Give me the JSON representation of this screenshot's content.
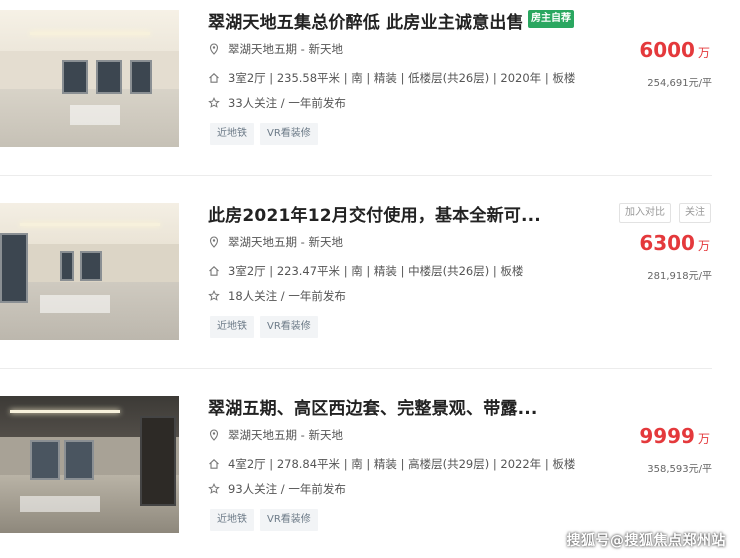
{
  "listings": [
    {
      "title": "翠湖天地五集总价醉低 此房业主诚意出售",
      "badge": "房主自荐",
      "location": "翠湖天地五期 - 新天地",
      "info": "3室2厅 | 235.58平米 | 南 | 精装 | 低楼层(共26层) | 2020年 | 板楼",
      "followers": "33人关注 / 一年前发布",
      "tags": [
        "近地铁",
        "VR看装修"
      ],
      "price": "6000",
      "price_unit": "万",
      "unit_price": "254,691元/平"
    },
    {
      "title": "此房2021年12月交付使用，基本全新可...",
      "compare_label": "加入对比",
      "follow_label": "关注",
      "location": "翠湖天地五期 - 新天地",
      "info": "3室2厅 | 223.47平米 | 南 | 精装 | 中楼层(共26层) | 板楼",
      "followers": "18人关注 / 一年前发布",
      "tags": [
        "近地铁",
        "VR看装修"
      ],
      "price": "6300",
      "price_unit": "万",
      "unit_price": "281,918元/平"
    },
    {
      "title": "翠湖五期、高区西边套、完整景观、带露...",
      "location": "翠湖天地五期 - 新天地",
      "info": "4室2厅 | 278.84平米 | 南 | 精装 | 高楼层(共29层) | 2022年 | 板楼",
      "followers": "93人关注 / 一年前发布",
      "tags": [
        "近地铁",
        "VR看装修"
      ],
      "price": "9999",
      "price_unit": "万",
      "unit_price": "358,593元/平"
    }
  ],
  "watermark": "搜狐号@搜狐焦点郑州站",
  "colors": {
    "price": "#e4393c",
    "badge": "#2aa760",
    "tag_bg": "#f2f4f6",
    "tag_text": "#6c7a87"
  },
  "icons": {
    "location": "location-pin-icon",
    "house": "house-icon",
    "follow": "star-icon"
  }
}
